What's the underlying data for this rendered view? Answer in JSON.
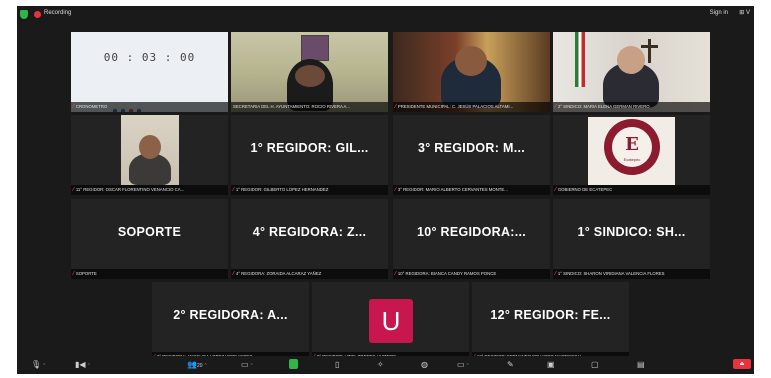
{
  "app": {
    "recording_label": "Recording",
    "sign_in_label": "Sign in",
    "view_label": "⊞ V"
  },
  "tiles": {
    "t1": {
      "timer": "00 : 03 : 00",
      "name": "CRONOMETRO"
    },
    "t2": {
      "name": "SECRETARIA DEL H. AYUNTAMIENTO: ROCIO RIVERA A..."
    },
    "t3": {
      "name": "PRESIDENTE MUNICIPAL: C. JESÚS PALACIOS ALTAMI..."
    },
    "t4": {
      "name": "2° SINDICO: MARIA ELENA GERMAN RIVERO"
    },
    "t5": {
      "name": "11° REGIDOR: OSCAR FLORENTINO VENANCIO CA..."
    },
    "t6": {
      "display": "1° REGIDOR: GIL...",
      "name": "1° REGIDOR: GILBERTO LOPEZ HERNANDEZ"
    },
    "t7": {
      "display": "3° REGIDOR: M...",
      "name": "3° REGIDOR: MARIO ALBERTO CERVANTES MONTE..."
    },
    "t8": {
      "logo_text": "Ecatepec",
      "name": "GOBIERNO DE ECATEPEC"
    },
    "t9": {
      "display": "SOPORTE",
      "name": "SOPORTE"
    },
    "t10": {
      "display": "4° REGIDORA: Z...",
      "name": "4° REGIDORA: ZORAIDA ALCARAZ YAÑEZ"
    },
    "t11": {
      "display": "10° REGIDORA:...",
      "name": "10° REGIDORA: BIANCA CANDY RAMOS PONCE"
    },
    "t12": {
      "display": "1° SINDICO: SH...",
      "name": "1° SINDICO: SHARON VIRIDIANA VALENCIA FLORES"
    },
    "t13": {
      "display": "2° REGIDORA: A...",
      "name": "2° REGIDORA: ANGELICA LOPEZ HERNANDEZ"
    },
    "t14": {
      "avatar_letter": "U",
      "name": "8° REGIDOR: UZIEL TORRES HUITRON"
    },
    "t15": {
      "display": "12° REGIDOR: FE...",
      "name": "12° REGIDOR: FERNANDO EDUARDO MARTINEZ V..."
    }
  },
  "toolbar": {
    "participants_count": "20"
  },
  "colors": {
    "background": "#1a1a1a",
    "tile": "#232323",
    "active_border": "#cfe25a",
    "mic_off": "#ff4a4a",
    "recording": "#e8323c",
    "avatar": "#c8174f",
    "ecatepec": "#8c1b2f"
  },
  "icons": {
    "security": "shield-icon",
    "recording": "record-dot-icon",
    "mic_off": "mic-off-icon",
    "mute": "microphone-icon",
    "video": "video-camera-icon",
    "participants": "people-icon",
    "chat": "chat-bubble-icon",
    "share": "share-screen-icon",
    "record": "record-icon",
    "reactions": "reactions-icon",
    "apps": "apps-icon",
    "whiteboard": "whiteboard-icon",
    "notes": "notes-icon",
    "more": "more-icon",
    "leave": "leave-icon"
  }
}
